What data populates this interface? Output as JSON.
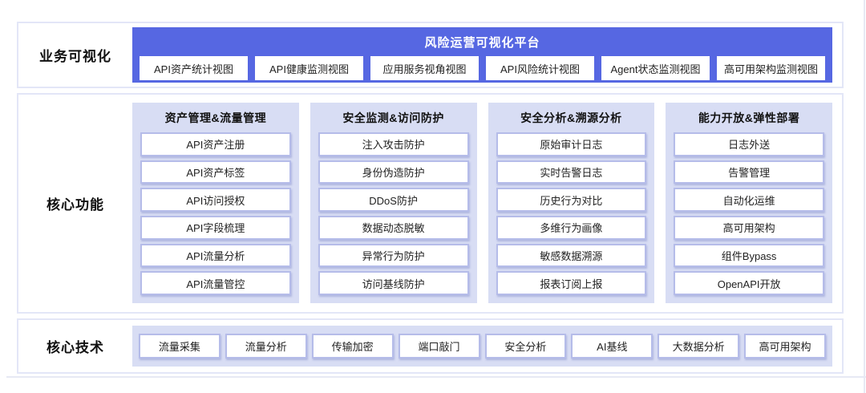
{
  "colors": {
    "banner_blue": "#5667e2",
    "panel_lavender": "#d8ddf4",
    "box_border": "#b5bce9",
    "section_border": "#e3e6f7"
  },
  "sections": {
    "visualization": {
      "label": "业务可视化",
      "platform_title": "风险运营可视化平台",
      "views": [
        "API资产统计视图",
        "API健康监测视图",
        "应用服务视角视图",
        "API风险统计视图",
        "Agent状态监测视图",
        "高可用架构监测视图"
      ]
    },
    "core_functions": {
      "label": "核心功能",
      "columns": [
        {
          "header": "资产管理&流量管理",
          "items": [
            "API资产注册",
            "API资产标签",
            "API访问授权",
            "API字段梳理",
            "API流量分析",
            "API流量管控"
          ]
        },
        {
          "header": "安全监测&访问防护",
          "items": [
            "注入攻击防护",
            "身份伪造防护",
            "DDoS防护",
            "数据动态脱敏",
            "异常行为防护",
            "访问基线防护"
          ]
        },
        {
          "header": "安全分析&溯源分析",
          "items": [
            "原始审计日志",
            "实时告警日志",
            "历史行为对比",
            "多维行为画像",
            "敏感数据溯源",
            "报表订阅上报"
          ]
        },
        {
          "header": "能力开放&弹性部署",
          "items": [
            "日志外送",
            "告警管理",
            "自动化运维",
            "高可用架构",
            "组件Bypass",
            "OpenAPI开放"
          ]
        }
      ]
    },
    "core_technologies": {
      "label": "核心技术",
      "items": [
        "流量采集",
        "流量分析",
        "传输加密",
        "端口敲门",
        "安全分析",
        "AI基线",
        "大数据分析",
        "高可用架构"
      ]
    }
  }
}
